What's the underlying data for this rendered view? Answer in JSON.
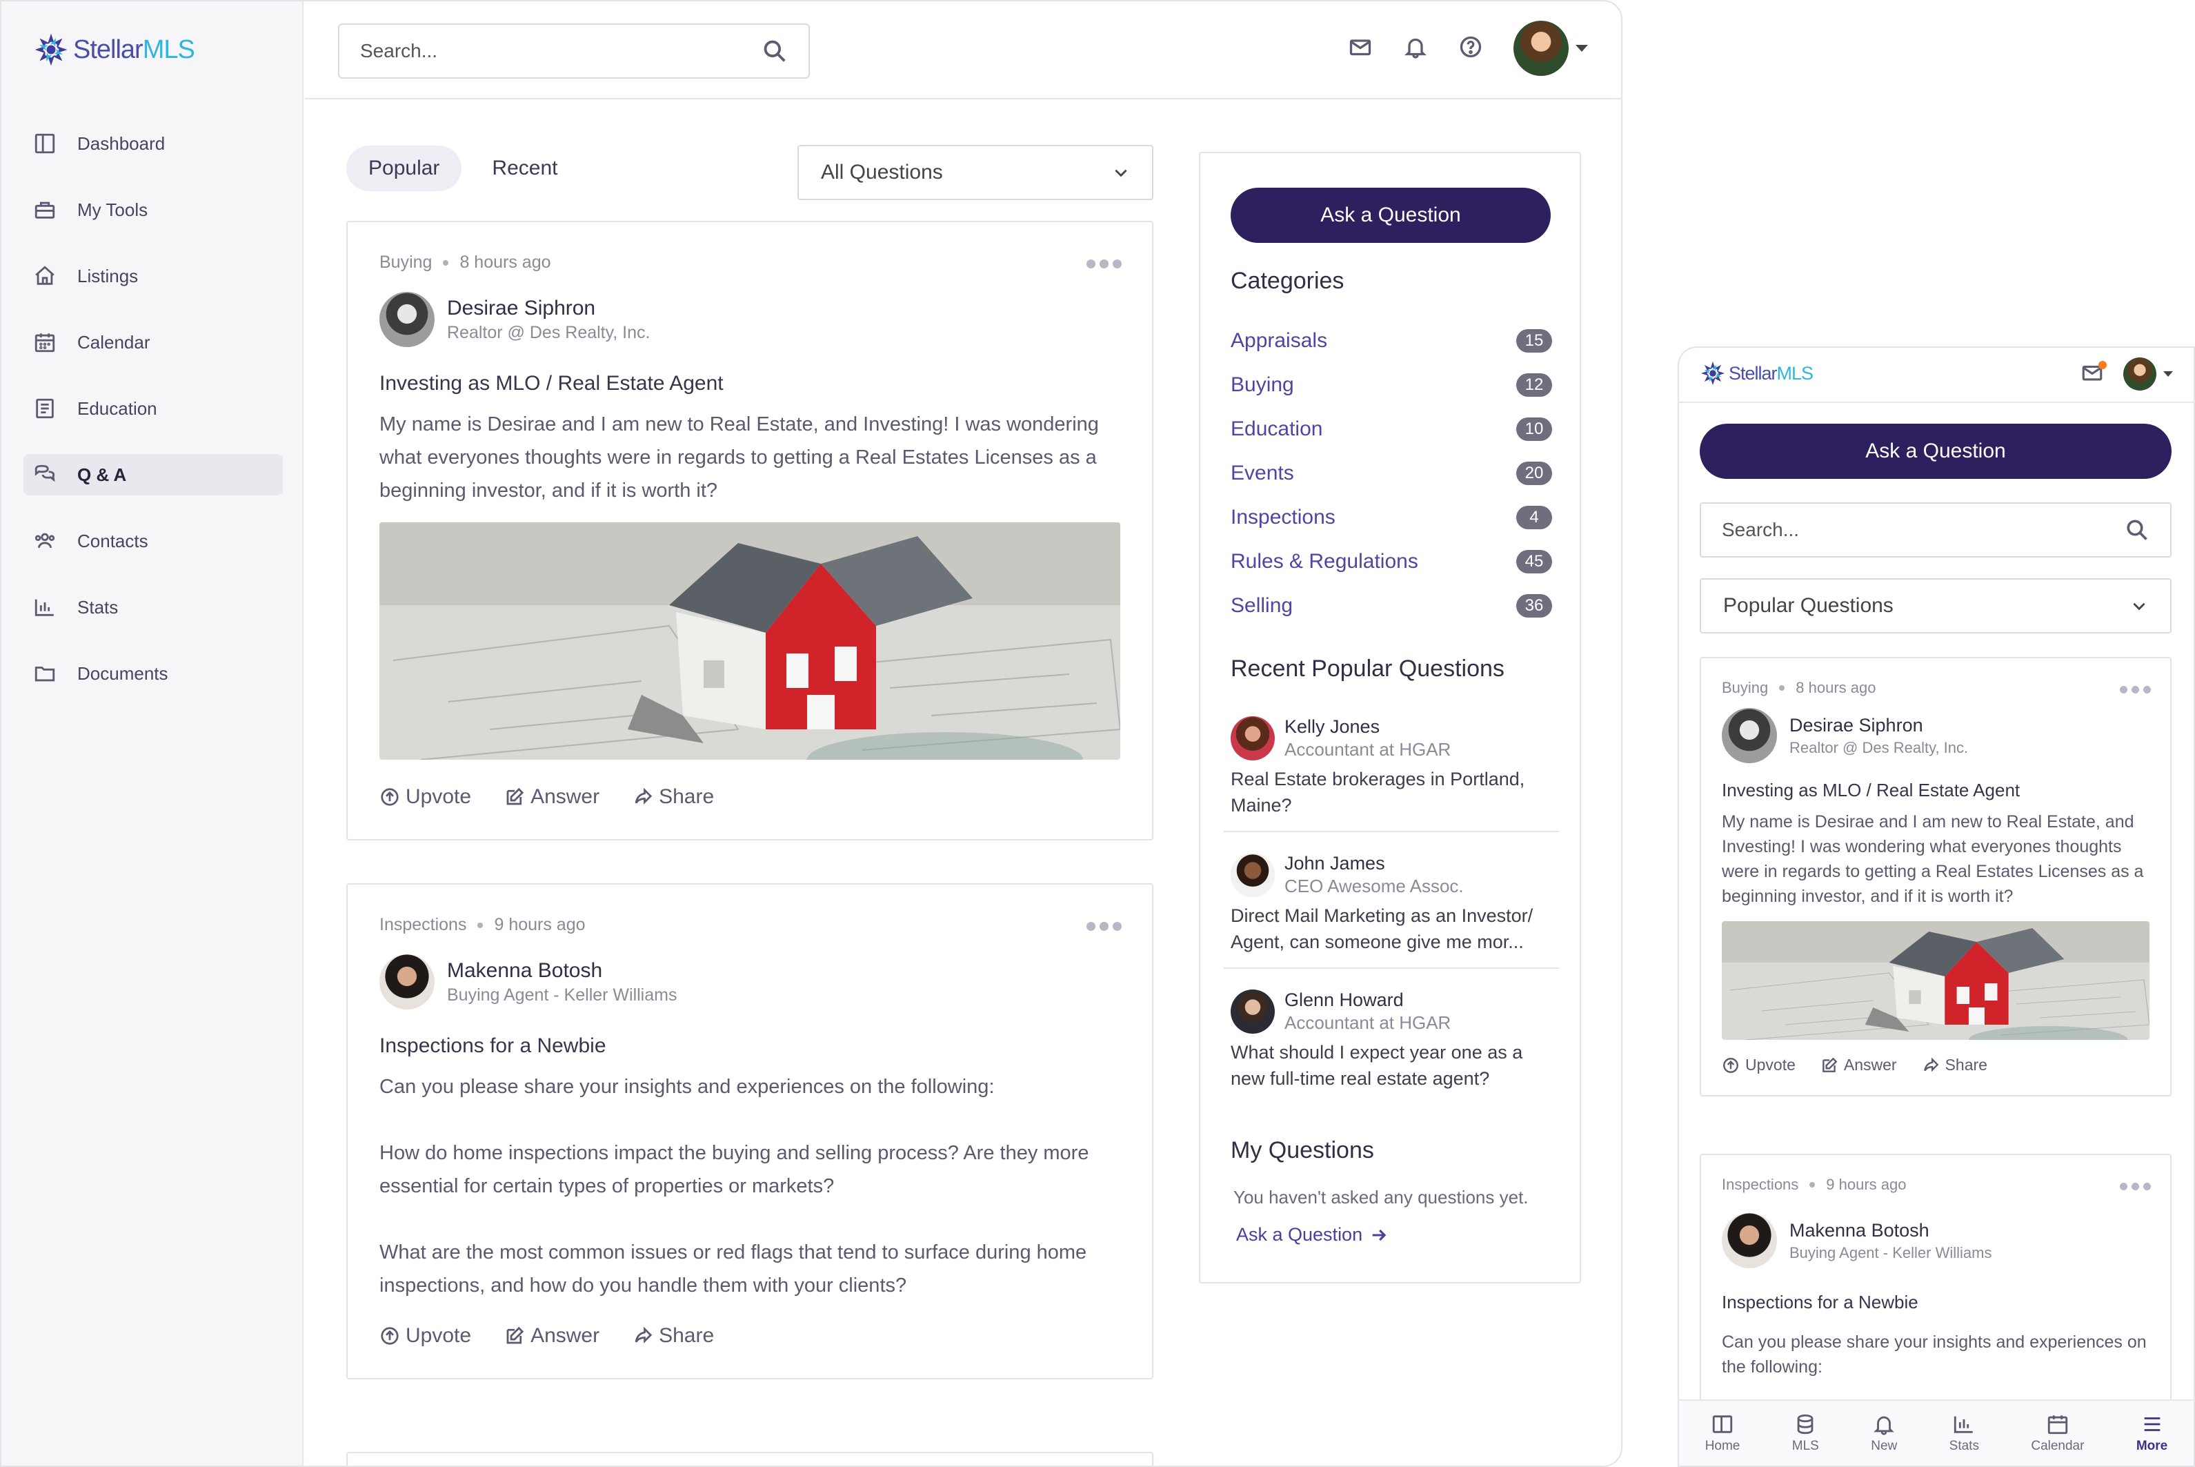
{
  "brand": {
    "part1": "Stellar",
    "part2": "MLS"
  },
  "sidebar": {
    "items": [
      {
        "label": "Dashboard",
        "icon": "dashboard-icon"
      },
      {
        "label": "My Tools",
        "icon": "toolbox-icon"
      },
      {
        "label": "Listings",
        "icon": "home-icon"
      },
      {
        "label": "Calendar",
        "icon": "calendar-icon"
      },
      {
        "label": "Education",
        "icon": "education-icon"
      },
      {
        "label": "Q & A",
        "icon": "chat-icon",
        "active": true
      },
      {
        "label": "Contacts",
        "icon": "contacts-icon"
      },
      {
        "label": "Stats",
        "icon": "stats-icon"
      },
      {
        "label": "Documents",
        "icon": "folder-icon"
      }
    ]
  },
  "topbar": {
    "search_placeholder": "Search..."
  },
  "feed": {
    "tabs": [
      {
        "label": "Popular",
        "active": true
      },
      {
        "label": "Recent"
      }
    ],
    "filter": "All Questions",
    "posts": [
      {
        "category": "Buying",
        "time": "8 hours ago",
        "author": "Desirae Siphron",
        "role": "Realtor @ Des Realty, Inc.",
        "title": "Investing as MLO / Real Estate Agent",
        "body": "My name is Desirae and I am new to Real Estate, and Investing!  I was wondering what everyones thoughts were in regards to getting a Real Estates Licenses as a beginning investor, and if it is worth it?"
      },
      {
        "category": "Inspections",
        "time": "9 hours ago",
        "author": "Makenna Botosh",
        "role": "Buying Agent - Keller Williams",
        "title": "Inspections for a Newbie",
        "body_paragraphs": [
          "Can you please share your insights and experiences on the following:",
          "How do home inspections impact the buying and selling process? Are they more essential for certain types of properties or markets?",
          "What are the most common issues or red flags that tend to surface during home inspections, and how do you handle them with your clients?"
        ]
      }
    ],
    "actions": {
      "upvote": "Upvote",
      "answer": "Answer",
      "share": "Share"
    }
  },
  "right_panel": {
    "ask_button": "Ask a Question",
    "categories_title": "Categories",
    "categories": [
      {
        "name": "Appraisals",
        "count": "15"
      },
      {
        "name": "Buying",
        "count": "12"
      },
      {
        "name": "Education",
        "count": "10"
      },
      {
        "name": "Events",
        "count": "20"
      },
      {
        "name": "Inspections",
        "count": "4"
      },
      {
        "name": "Rules & Regulations",
        "count": "45"
      },
      {
        "name": "Selling",
        "count": "36"
      }
    ],
    "recent_title": "Recent Popular Questions",
    "recent": [
      {
        "name": "Kelly Jones",
        "role": "Accountant at HGAR",
        "question": "Real Estate brokerages in Portland, Maine?"
      },
      {
        "name": "John James",
        "role": "CEO Awesome Assoc.",
        "question": "Direct Mail Marketing as an Investor/ Agent, can someone give me mor..."
      },
      {
        "name": "Glenn Howard",
        "role": "Accountant at HGAR",
        "question": "What should I expect year one as a new full-time real estate agent?"
      }
    ],
    "my_questions_title": "My Questions",
    "my_questions_empty": "You haven't asked any questions yet.",
    "my_questions_link": "Ask a Question"
  },
  "mobile": {
    "ask_button": "Ask a Question",
    "search_placeholder": "Search...",
    "filter": "Popular Questions",
    "post1": {
      "category": "Buying",
      "time": "8 hours ago",
      "author": "Desirae Siphron",
      "role": "Realtor @ Des Realty, Inc.",
      "title": "Investing as MLO / Real Estate Agent",
      "body": "My name is Desirae and I am new to Real Estate, and Investing!  I was wondering what everyones thoughts were in regards to getting a Real Estates Licenses as a beginning investor, and if it is worth it?"
    },
    "post2": {
      "category": "Inspections",
      "time": "9 hours ago",
      "author": "Makenna Botosh",
      "role": "Buying Agent - Keller Williams",
      "title": "Inspections for a Newbie",
      "body": "Can you please share your insights and experiences on the following:"
    },
    "bottom_nav": [
      {
        "label": "Home",
        "icon": "home-panel-icon"
      },
      {
        "label": "MLS",
        "icon": "database-icon"
      },
      {
        "label": "New",
        "icon": "bell-icon"
      },
      {
        "label": "Stats",
        "icon": "stats-icon"
      },
      {
        "label": "Calendar",
        "icon": "calendar-icon"
      },
      {
        "label": "More",
        "icon": "menu-icon",
        "active": true
      }
    ]
  }
}
